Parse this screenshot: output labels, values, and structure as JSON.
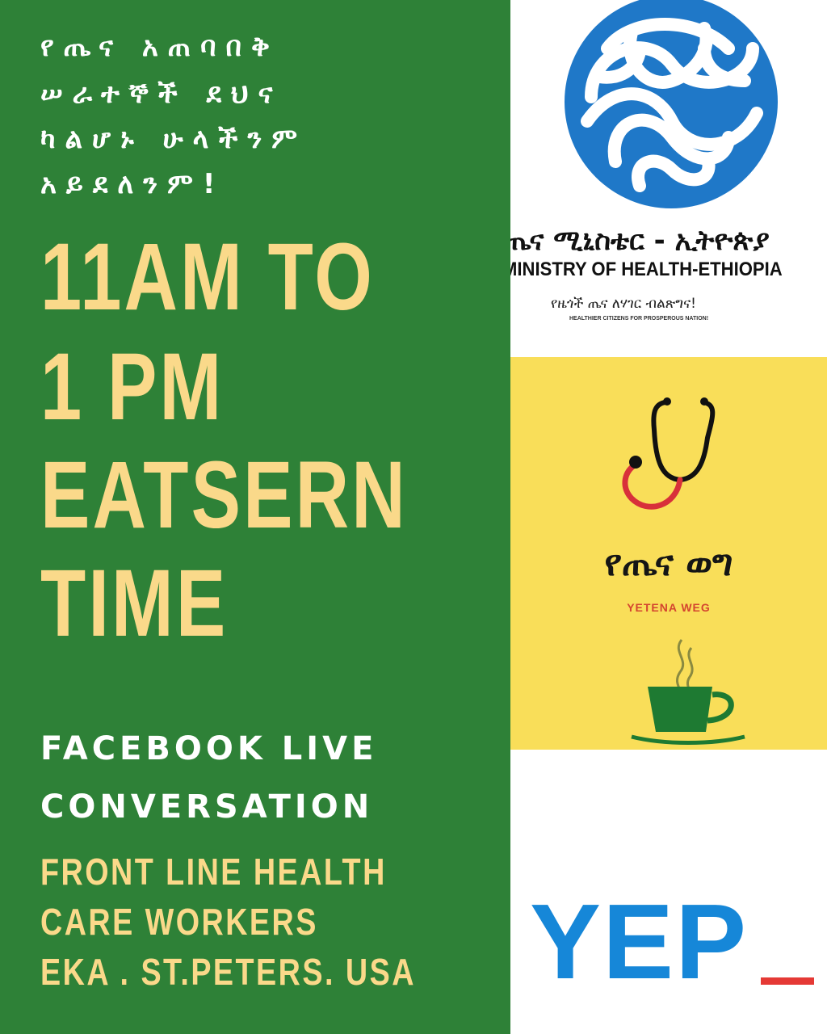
{
  "left": {
    "amharic_lines": [
      "የጤና አጠባበቅ",
      "ሠራተኞች ደህና",
      "ካልሆኑ ሁላችንም",
      "አይደለንም!"
    ],
    "time_lines": [
      "11AM TO",
      "1 PM",
      "EATSERN",
      "TIME"
    ],
    "facebook_lines": [
      "FACEBOOK LIVE",
      "CONVERSATION"
    ],
    "detail_lines": [
      "FRONT LINE HEALTH",
      "CARE WORKERS",
      "EKA . ST.PETERS. USA"
    ]
  },
  "logos": {
    "moh": {
      "amharic": "ጤና ሚኒስቴር - ኢትዮጵያ",
      "english": "MINISTRY OF HEALTH-ETHIOPIA",
      "slogan_amharic": "የዜጎች ጤና ለሃገር ብልጽግና!",
      "slogan_english": "HEALTHIER CITIZENS FOR PROSPEROUS NATION!"
    },
    "yetena_weg": {
      "amharic": "የጤና ወግ",
      "english": "YETENA WEG"
    },
    "yep": {
      "text": "YEP"
    }
  },
  "colors": {
    "left_background": "#2e8137",
    "headline_yellow": "#fad98a",
    "moh_blue": "#1f78c8",
    "yetena_background": "#f9de59",
    "yep_blue": "#1687d8",
    "yep_red": "#e53935"
  }
}
